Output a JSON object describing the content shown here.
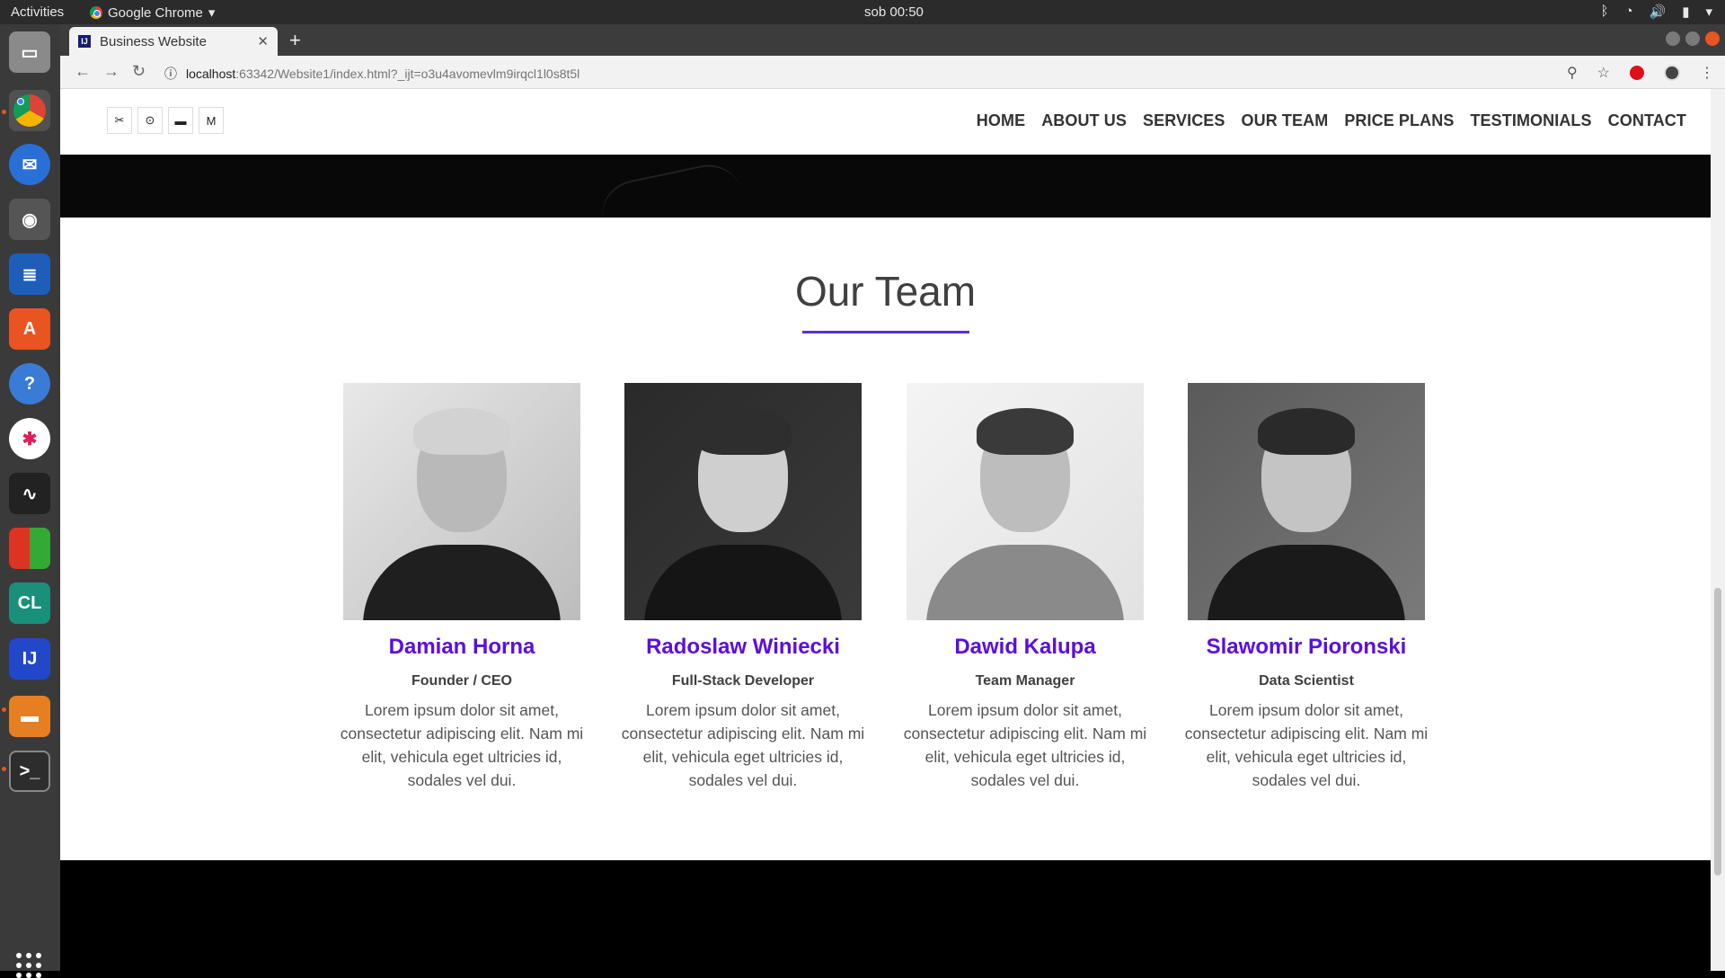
{
  "os": {
    "activities": "Activities",
    "app_name": "Google Chrome",
    "clock": "sob 00:50"
  },
  "browser": {
    "tab_title": "Business Website",
    "url_host": "localhost",
    "url_rest": ":63342/Website1/index.html?_ijt=o3u4avomevlm9irqcl1l0s8t5l"
  },
  "site": {
    "nav": [
      "HOME",
      "ABOUT US",
      "SERVICES",
      "OUR TEAM",
      "PRICE PLANS",
      "TESTIMONIALS",
      "CONTACT"
    ],
    "logo_glyphs": [
      "✂",
      "⊙",
      "▬",
      "M"
    ]
  },
  "team": {
    "title": "Our Team",
    "accent_color": "#5b0ee0",
    "members": [
      {
        "name": "Damian Horna",
        "role": "Founder / CEO",
        "desc": "Lorem ipsum dolor sit amet, consectetur adipiscing elit. Nam mi elit, vehicula eget ultricies id, sodales vel dui."
      },
      {
        "name": "Radoslaw Winiecki",
        "role": "Full-Stack Developer",
        "desc": "Lorem ipsum dolor sit amet, consectetur adipiscing elit. Nam mi elit, vehicula eget ultricies id, sodales vel dui."
      },
      {
        "name": "Dawid Kalupa",
        "role": "Team Manager",
        "desc": "Lorem ipsum dolor sit amet, consectetur adipiscing elit. Nam mi elit, vehicula eget ultricies id, sodales vel dui."
      },
      {
        "name": "Slawomir Pioronski",
        "role": "Data Scientist",
        "desc": "Lorem ipsum dolor sit amet, consectetur adipiscing elit. Nam mi elit, vehicula eget ultricies id, sodales vel dui."
      }
    ]
  }
}
